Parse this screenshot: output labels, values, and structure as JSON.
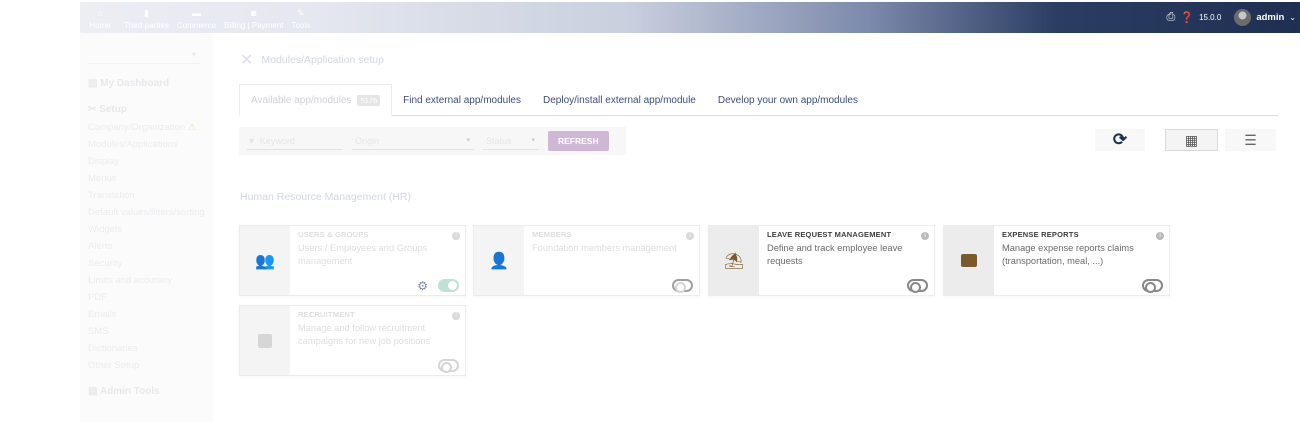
{
  "topnav": {
    "items": [
      {
        "label": "Home",
        "icon": "home-icon",
        "glyph": "⌂"
      },
      {
        "label": "Third-parties",
        "icon": "building-icon",
        "glyph": "▮"
      },
      {
        "label": "Commerce",
        "icon": "briefcase-icon",
        "glyph": "▬"
      },
      {
        "label": "Billing | Payment",
        "icon": "coins-icon",
        "glyph": "◙"
      },
      {
        "label": "Tools",
        "icon": "wrench-icon",
        "glyph": "✎"
      }
    ],
    "version": "15.0.0",
    "user": "admin"
  },
  "sidebar": {
    "select_value": "",
    "dashboard": "My Dashboard",
    "setup": "Setup",
    "items": [
      "Company/Organization",
      "Modules/Applications",
      "Display",
      "Menus",
      "Translation",
      "Default values/filters/sorting",
      "Widgets",
      "Alerts",
      "Security",
      "Limits and accuracy",
      "PDF",
      "Emails",
      "SMS",
      "Dictionaries",
      "Other Setup"
    ],
    "admin_tools": "Admin Tools"
  },
  "page": {
    "title": "Modules/Application setup"
  },
  "tabs": [
    {
      "label": "Available app/modules",
      "badge": "5176"
    },
    {
      "label": "Find external app/modules"
    },
    {
      "label": "Deploy/install external app/module"
    },
    {
      "label": "Develop your own app/modules"
    }
  ],
  "filters": {
    "keyword_placeholder": "Keyword",
    "origin_placeholder": "Origin",
    "status_placeholder": "Status",
    "refresh_label": "REFRESH"
  },
  "section": {
    "title": "Human Resource Management (HR)"
  },
  "cards": [
    {
      "title": "USERS & GROUPS",
      "desc": "Users / Employees and Groups management",
      "icon": "users-icon",
      "glyph": "👥",
      "enabled": true
    },
    {
      "title": "MEMBERS",
      "desc": "Foundation members management",
      "icon": "member-icon",
      "glyph": "👤",
      "enabled": false
    },
    {
      "title": "LEAVE REQUEST MANAGEMENT",
      "desc": "Define and track employee leave requests",
      "icon": "beach-umbrella-icon",
      "glyph": "⛱",
      "enabled": false
    },
    {
      "title": "EXPENSE REPORTS",
      "desc": "Manage expense reports claims (transportation, meal, ...)",
      "icon": "wallet-icon",
      "glyph": "▣",
      "enabled": false
    },
    {
      "title": "RECRUITMENT",
      "desc": "Manage and follow recruitment campaigns for new job positions",
      "icon": "id-badge-icon",
      "glyph": "▤",
      "enabled": false
    }
  ]
}
